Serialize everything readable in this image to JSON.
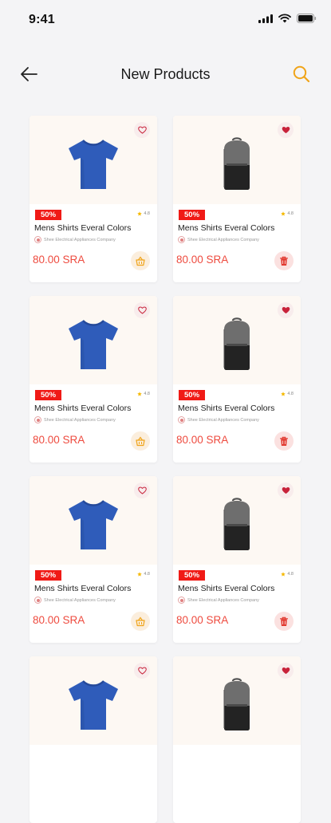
{
  "status_bar": {
    "time": "9:41"
  },
  "header": {
    "title": "New Products"
  },
  "colors": {
    "accent": "#f0a419",
    "discount": "#f01a16",
    "price": "#ee4b3f",
    "heart_filled": "#c8223a"
  },
  "products": [
    {
      "type": "tshirt",
      "discount": "50%",
      "rating": "4.8",
      "name": "Mens Shirts Everal Colors",
      "company": "Shee Electrical Appliances Company",
      "price": "80.00 SRA",
      "favorited": false,
      "action": "cart-icon"
    },
    {
      "type": "backpack",
      "discount": "50%",
      "rating": "4.8",
      "name": "Mens Shirts Everal Colors",
      "company": "Shee Electrical Appliances Company",
      "price": "80.00 SRA",
      "favorited": true,
      "action": "trash-icon"
    },
    {
      "type": "tshirt",
      "discount": "50%",
      "rating": "4.8",
      "name": "Mens Shirts Everal Colors",
      "company": "Shee Electrical Appliances Company",
      "price": "80.00 SRA",
      "favorited": false,
      "action": "cart-icon"
    },
    {
      "type": "backpack",
      "discount": "50%",
      "rating": "4.8",
      "name": "Mens Shirts Everal Colors",
      "company": "Shee Electrical Appliances Company",
      "price": "80.00 SRA",
      "favorited": true,
      "action": "trash-icon"
    },
    {
      "type": "tshirt",
      "discount": "50%",
      "rating": "4.8",
      "name": "Mens Shirts Everal Colors",
      "company": "Shee Electrical Appliances Company",
      "price": "80.00 SRA",
      "favorited": false,
      "action": "cart-icon"
    },
    {
      "type": "backpack",
      "discount": "50%",
      "rating": "4.8",
      "name": "Mens Shirts Everal Colors",
      "company": "Shee Electrical Appliances Company",
      "price": "80.00 SRA",
      "favorited": true,
      "action": "trash-icon"
    },
    {
      "type": "tshirt",
      "favorited": false
    },
    {
      "type": "backpack",
      "favorited": true
    }
  ]
}
